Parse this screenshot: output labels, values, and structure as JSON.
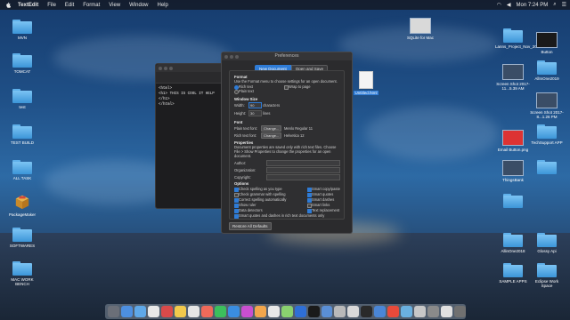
{
  "menubar": {
    "app": "TextEdit",
    "items": [
      "File",
      "Edit",
      "Format",
      "View",
      "Window",
      "Help"
    ],
    "clock": "Mon 7:24 PM"
  },
  "desktop_left": [
    {
      "label": "MVN",
      "kind": "folder"
    },
    {
      "label": "TOMCAT",
      "kind": "folder"
    },
    {
      "label": "test",
      "kind": "folder"
    },
    {
      "label": "TEST BUILD",
      "kind": "folder"
    },
    {
      "label": "ALL TASK",
      "kind": "folder"
    },
    {
      "label": "PackageMaker",
      "kind": "package"
    },
    {
      "label": "SOFTWARES",
      "kind": "folder"
    },
    {
      "label": "MAC WORK BENCH",
      "kind": "folder"
    }
  ],
  "desktop_right": [
    {
      "label": "SQLite for Mac",
      "kind": "thumb"
    },
    {
      "label": "Lanns_Project_Nov_2017",
      "kind": "folder"
    },
    {
      "label": "Button",
      "kind": "thumb"
    },
    {
      "label": "Screen Shot 2017-11...5.39 AM",
      "kind": "thumb"
    },
    {
      "label": "AllInOne2019",
      "kind": "folder"
    },
    {
      "label": "Screen Shot 2017-8...1.26 PM",
      "kind": "thumb"
    },
    {
      "label": "Email Button.png",
      "kind": "thumb"
    },
    {
      "label": "TechSupport APP",
      "kind": "folder"
    },
    {
      "label": "ThingsBank",
      "kind": "folder"
    },
    {
      "label": "",
      "kind": "folder"
    },
    {
      "label": "",
      "kind": "folder"
    },
    {
      "label": "AllinOne2018",
      "kind": "folder"
    },
    {
      "label": "Glossy Api",
      "kind": "folder"
    },
    {
      "label": "SAMPLE APPS",
      "kind": "folder"
    },
    {
      "label": "Eclipse Work Space",
      "kind": "folder"
    }
  ],
  "file_icon": {
    "label": "Untitled.html"
  },
  "textedit": {
    "lines": [
      "<html>",
      "<h1> THIS IS COOL IT HELP </h1>",
      "</html>"
    ]
  },
  "prefs": {
    "title": "Preferences",
    "tabs": [
      "New Document",
      "Open and Save"
    ],
    "format": {
      "heading": "Format",
      "desc": "Use the Format menu to choose settings for an open document.",
      "rich": "Rich text",
      "plain": "Plain text",
      "wrap": "Wrap to page"
    },
    "window_size": {
      "heading": "Window Size",
      "width_label": "Width:",
      "width_value": "90",
      "width_unit": "characters",
      "height_label": "Height:",
      "height_value": "30",
      "height_unit": "lines"
    },
    "font": {
      "heading": "Font",
      "plain_label": "Plain text font:",
      "plain_btn": "Change...",
      "plain_value": "Menlo Regular 11",
      "rich_label": "Rich text font:",
      "rich_btn": "Change...",
      "rich_value": "Helvetica 12"
    },
    "properties": {
      "heading": "Properties",
      "desc": "Document properties are saved only with rich text files. Choose File > Show Properties to change the properties for an open document.",
      "author": "Author:",
      "organization": "Organization:",
      "copyright": "Copyright:"
    },
    "options": {
      "heading": "Options",
      "left": [
        "Check spelling as you type",
        "Check grammar with spelling",
        "Correct spelling automatically",
        "Show ruler",
        "Data detectors",
        "Smart quotes and dashes in rich text documents only"
      ],
      "right": [
        "Smart copy/paste",
        "Smart quotes",
        "Smart dashes",
        "Smart links",
        "Text replacement"
      ]
    },
    "restore": "Restore All Defaults"
  },
  "dock_colors": [
    "#6b6f78",
    "#4d8fe0",
    "#5fa8e8",
    "#e8e8e8",
    "#d94a4a",
    "#f2c94c",
    "#e5e5e5",
    "#f06a5a",
    "#3cbf5c",
    "#3a8de0",
    "#c94fd0",
    "#f2a64c",
    "#e8e8e8",
    "#8ad16f",
    "#2f6fd6",
    "#1a1a1a",
    "#5a8fd6",
    "#b9b9b9",
    "#d9d9d9",
    "#2a2a2a",
    "#4a86d6",
    "#e84a3a",
    "#6ab0e0",
    "#c7c7c7",
    "#8a8a8a",
    "#e0e0e0",
    "#707070"
  ]
}
